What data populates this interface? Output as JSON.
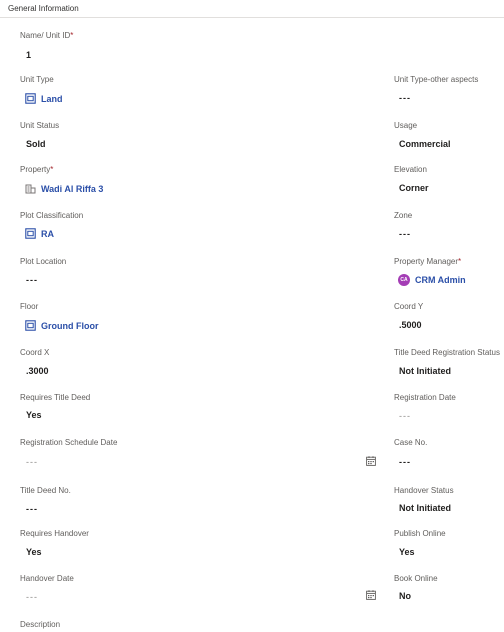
{
  "section_title": "General Information",
  "required_mark": "*",
  "calendar_icon": "calendar-icon",
  "left": {
    "name": {
      "label": "Name/ Unit ID",
      "value": "1"
    },
    "unit_type": {
      "label": "Unit Type",
      "value": "Land",
      "icon": "entity-icon"
    },
    "unit_status": {
      "label": "Unit Status",
      "value": "Sold"
    },
    "property": {
      "label": "Property",
      "value": "Wadi Al Riffa 3",
      "icon": "building-icon"
    },
    "plot_classification": {
      "label": "Plot Classification",
      "value": "RA",
      "icon": "entity-icon"
    },
    "plot_location": {
      "label": "Plot Location",
      "value": "---"
    },
    "floor": {
      "label": "Floor",
      "value": "Ground Floor",
      "icon": "entity-icon"
    },
    "coord_x": {
      "label": "Coord X",
      "value": ".3000"
    },
    "requires_title_deed": {
      "label": "Requires Title Deed",
      "value": "Yes"
    },
    "registration_schedule_date": {
      "label": "Registration Schedule Date",
      "value": "---"
    },
    "title_deed_no": {
      "label": "Title Deed No.",
      "value": "---"
    },
    "requires_handover": {
      "label": "Requires Handover",
      "value": "Yes"
    },
    "handover_date": {
      "label": "Handover Date",
      "value": "---"
    },
    "description": {
      "label": "Description"
    }
  },
  "right": {
    "unit_type_other": {
      "label": "Unit Type-other aspects",
      "value": "---"
    },
    "usage": {
      "label": "Usage",
      "value": "Commercial"
    },
    "elevation": {
      "label": "Elevation",
      "value": "Corner"
    },
    "zone": {
      "label": "Zone",
      "value": "---"
    },
    "property_manager": {
      "label": "Property Manager",
      "value": "CRM Admin",
      "initials": "CA",
      "avatar_color": "#a43db5"
    },
    "coord_y": {
      "label": "Coord Y",
      "value": ".5000"
    },
    "title_deed_registration_status": {
      "label": "Title Deed Registration Status",
      "value": "Not Initiated"
    },
    "registration_date": {
      "label": "Registration Date",
      "value": "---"
    },
    "case_no": {
      "label": "Case No.",
      "value": "---"
    },
    "handover_status": {
      "label": "Handover Status",
      "value": "Not Initiated"
    },
    "publish_online": {
      "label": "Publish Online",
      "value": "Yes"
    },
    "book_online": {
      "label": "Book Online",
      "value": "No"
    }
  },
  "colors": {
    "link": "#2b4fa8",
    "required": "#a4262c",
    "label": "#605e5c"
  }
}
